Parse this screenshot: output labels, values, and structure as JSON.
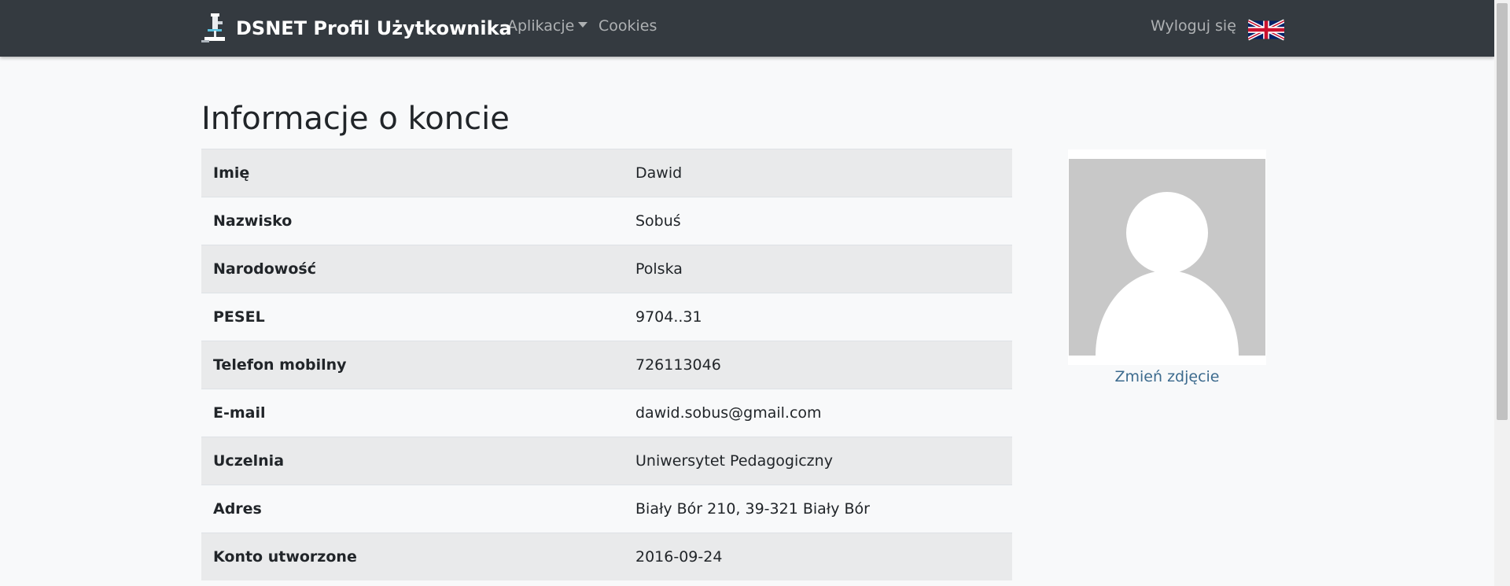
{
  "navbar": {
    "brand": "DSNET Profil Użytkownika",
    "apps_label": "Aplikacje",
    "cookies_label": "Cookies",
    "logout_label": "Wyloguj się",
    "bg_color": "#343a40"
  },
  "main": {
    "title": "Informacje o koncie",
    "rows": [
      {
        "label": "Imię",
        "value": "Dawid"
      },
      {
        "label": "Nazwisko",
        "value": "Sobuś"
      },
      {
        "label": "Narodowość",
        "value": "Polska"
      },
      {
        "label": "PESEL",
        "value": "9704..31"
      },
      {
        "label": "Telefon mobilny",
        "value": "726113046"
      },
      {
        "label": "E-mail",
        "value": "dawid.sobus@gmail.com"
      },
      {
        "label": "Uczelnia",
        "value": "Uniwersytet Pedagogiczny"
      },
      {
        "label": "Adres",
        "value": "Biały Bór 210, 39-321 Biały Bór"
      },
      {
        "label": "Konto utworzone",
        "value": "2016-09-24"
      }
    ]
  },
  "sidebar": {
    "change_photo_label": "Zmień zdjęcie",
    "link_color": "#3d6b8e"
  },
  "icons": {
    "brand": "microscope-logo-icon",
    "language": "uk-flag-icon",
    "avatar": "default-avatar-icon"
  }
}
